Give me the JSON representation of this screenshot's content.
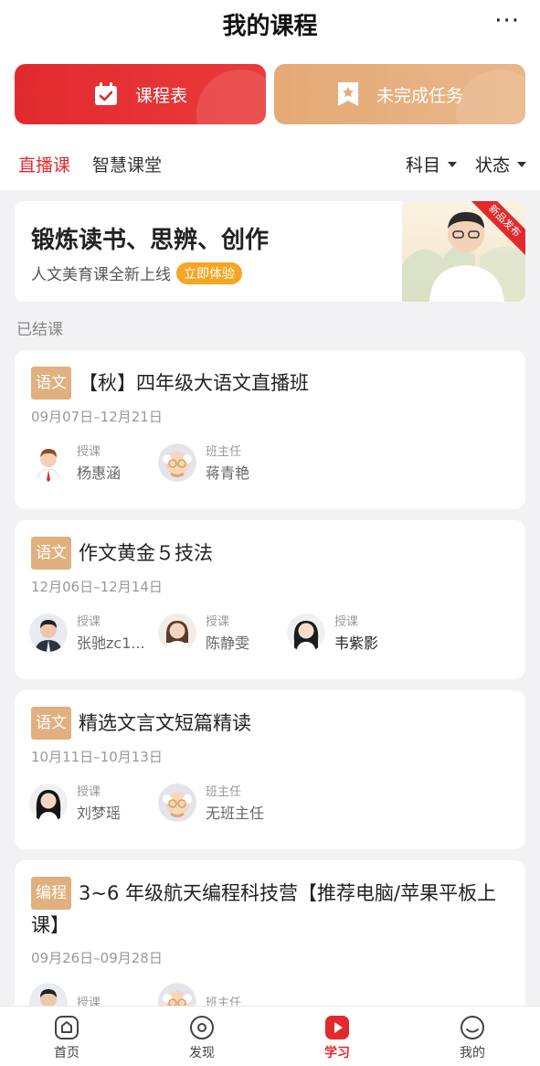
{
  "header": {
    "title": "我的课程",
    "more": "···"
  },
  "actions": {
    "schedule_label": "课程表",
    "tasks_label": "未完成任务"
  },
  "tabs": {
    "live": "直播课",
    "smart": "智慧课堂"
  },
  "filters": {
    "subject": "科目",
    "status": "状态"
  },
  "banner": {
    "headline": "锻炼读书、思辨、创作",
    "subtitle": "人文美育课全新上线",
    "cta": "立即体验",
    "ribbon": "新品发布"
  },
  "section": {
    "finished": "已结课"
  },
  "courses": [
    {
      "tag": "语文",
      "title": "【秋】四年级大语文直播班",
      "dates": "09月07日–12月21日",
      "people": [
        {
          "role": "授课",
          "name": "杨惠涵"
        },
        {
          "role": "班主任",
          "name": "蒋青艳"
        }
      ]
    },
    {
      "tag": "语文",
      "title": "作文黄金５技法",
      "dates": "12月06日–12月14日",
      "people": [
        {
          "role": "授课",
          "name": "张驰zc1..."
        },
        {
          "role": "授课",
          "name": "陈静雯"
        },
        {
          "role": "授课",
          "name": "韦紫影"
        }
      ]
    },
    {
      "tag": "语文",
      "title": "精选文言文短篇精读",
      "dates": "10月11日–10月13日",
      "people": [
        {
          "role": "授课",
          "name": "刘梦瑶"
        },
        {
          "role": "班主任",
          "name": "无班主任"
        }
      ]
    },
    {
      "tag": "编程",
      "title": "3~6 年级航天编程科技营【推荐电脑/苹果平板上课】",
      "dates": "09月26日–09月28日",
      "people": [
        {
          "role": "授课",
          "name": ""
        },
        {
          "role": "班主任",
          "name": ""
        }
      ]
    }
  ],
  "nav": {
    "home": "首页",
    "discover": "发现",
    "study": "学习",
    "mine": "我的"
  },
  "colors": {
    "accent": "#e22a2e",
    "tan": "#e5aa76",
    "tag": "#e0b07f"
  },
  "icons": [
    "calendar-check-icon",
    "bookmark-star-icon",
    "more-icon",
    "home-icon",
    "compass-icon",
    "play-icon",
    "smile-icon"
  ]
}
